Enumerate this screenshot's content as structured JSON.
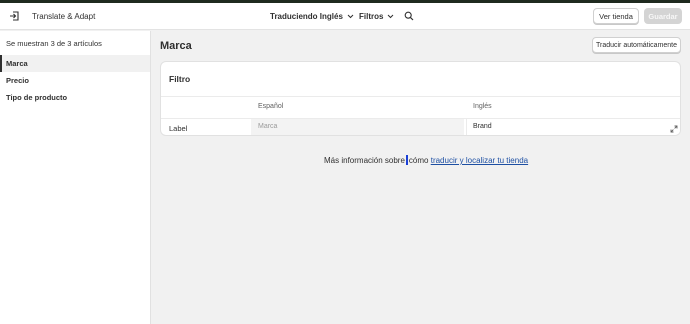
{
  "app": {
    "title": "Translate & Adapt"
  },
  "header": {
    "language_label": "Traduciendo Inglés",
    "filters_label": "Filtros",
    "view_store_label": "Ver tienda",
    "save_label": "Guardar"
  },
  "sidebar": {
    "count_text": "Se muestran 3 de 3 artículos",
    "items": [
      {
        "label": "Marca",
        "active": true
      },
      {
        "label": "Precio",
        "active": false
      },
      {
        "label": "Tipo de producto",
        "active": false
      }
    ]
  },
  "main": {
    "title": "Marca",
    "auto_translate_label": "Traducir automáticamente",
    "card": {
      "title": "Filtro",
      "columns": [
        "Español",
        "Inglés"
      ],
      "rows": [
        {
          "label": "Label",
          "source": "Marca",
          "target": "Brand"
        }
      ]
    },
    "footer": {
      "text_before_caret": "Más información sobre",
      "text_after_caret": "cómo",
      "link_text": "traducir y localizar tu tienda"
    }
  },
  "colors": {
    "link": "#1d4fa3",
    "caret": "#1a3fd6",
    "save_disabled": "#d4d4d4"
  }
}
